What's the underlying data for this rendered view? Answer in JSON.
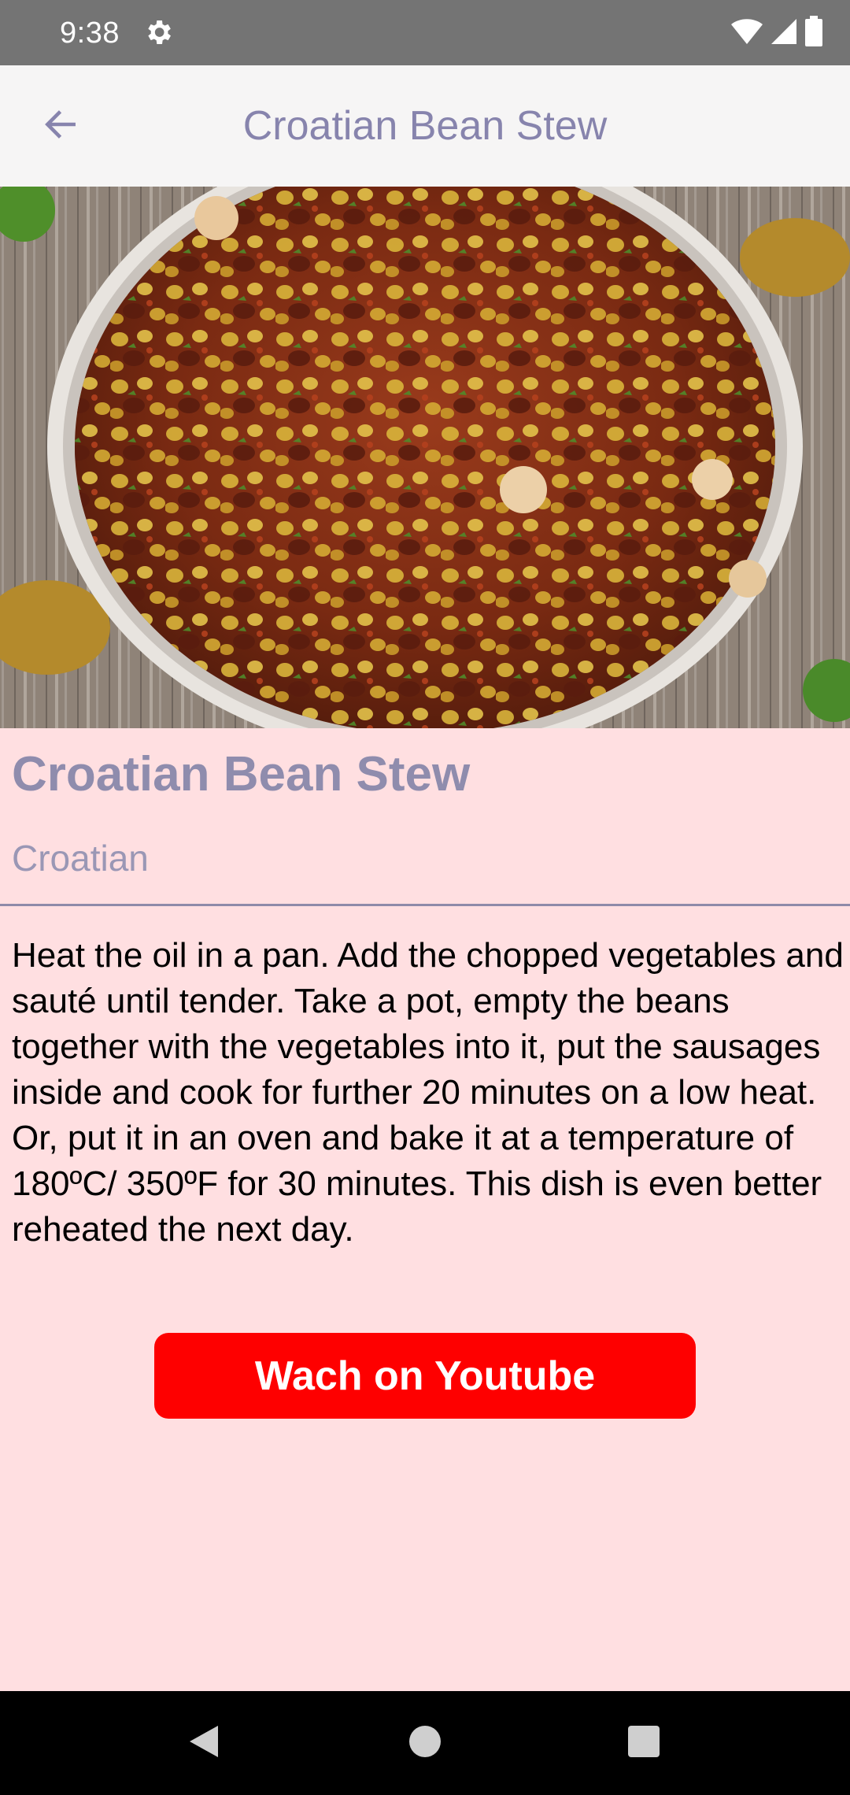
{
  "status_bar": {
    "time": "9:38",
    "icons": [
      "gear-icon",
      "wifi-icon",
      "signal-icon",
      "battery-icon"
    ]
  },
  "app_bar": {
    "title": "Croatian Bean Stew",
    "back_icon": "arrow-left-icon"
  },
  "recipe": {
    "title": "Croatian Bean Stew",
    "cuisine": "Croatian",
    "instructions": "Heat the oil in a pan. Add the chopped vegetables and sauté until tender. Take a pot, empty the beans together with the vegetables into it, put the sausages inside and cook for further 20 minutes on a low heat. Or, put it in an oven and bake it at a temperature of 180ºC/ 350ºF for 30 minutes. This dish is even better reheated the next day.",
    "youtube_button_label": "Wach on Youtube"
  },
  "nav_bar": {
    "icons": [
      "nav-back-icon",
      "nav-home-icon",
      "nav-recents-icon"
    ]
  },
  "colors": {
    "status_bar": "#747474",
    "app_bar": "#f6f5f5",
    "accent_text": "#8784ad",
    "page_background": "#ffdfe1",
    "youtube_button": "#fe0000",
    "nav_bar": "#000000"
  }
}
